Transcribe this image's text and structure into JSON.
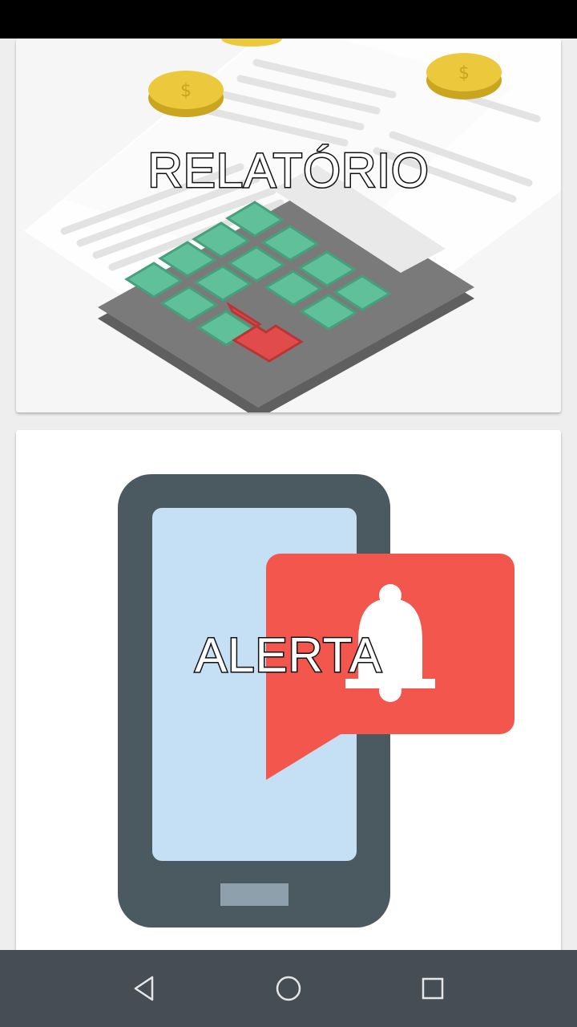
{
  "cards": [
    {
      "label": "RELATÓRIO",
      "icon": "calculator-report-icon"
    },
    {
      "label": "ALERTA",
      "icon": "phone-alert-bell-icon"
    }
  ],
  "navigation": {
    "back_icon": "back-triangle-icon",
    "home_icon": "home-circle-icon",
    "recents_icon": "recents-square-icon"
  },
  "colors": {
    "calculator_body": "#7a7a7a",
    "calculator_keys": "#5fc09a",
    "calculator_enter_key": "#e24b4b",
    "coin": "#e7c436",
    "phone_body": "#4b5961",
    "phone_screen": "#c5dff5",
    "alert_bubble": "#f2564d",
    "nav_bar": "#474d55"
  }
}
